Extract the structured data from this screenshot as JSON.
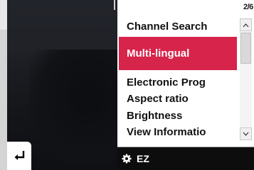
{
  "menu": {
    "page_indicator": "2/6",
    "items": [
      {
        "label": "Channel Search"
      },
      {
        "label": "Multi-lingual",
        "selected": true
      },
      {
        "label": "Electronic Prog"
      },
      {
        "label": "Aspect ratio"
      },
      {
        "label": "Brightness"
      },
      {
        "label": "View Informatio"
      }
    ],
    "selected_color": "#d6244a"
  },
  "bottom_bar": {
    "label": "EZ",
    "icon": "gear-icon"
  },
  "back_button": {
    "icon": "return-arrow-icon"
  },
  "scrollbar": {
    "up_icon": "chevron-up-icon",
    "down_icon": "chevron-down-icon"
  }
}
